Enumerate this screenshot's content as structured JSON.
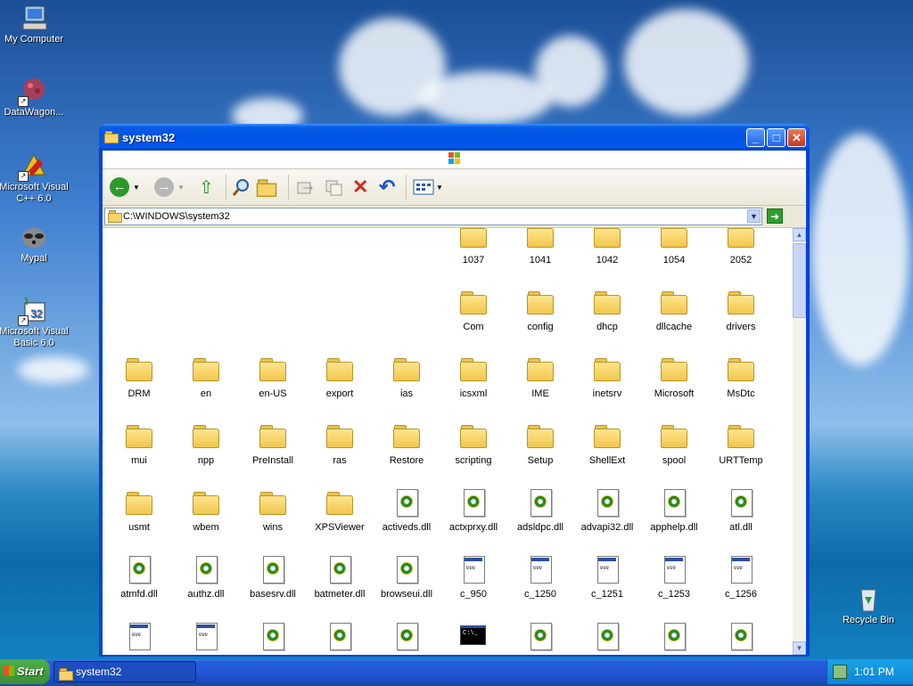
{
  "desktop": {
    "icons": [
      {
        "label": "My Computer"
      },
      {
        "label": "DataWagon..."
      },
      {
        "label": "Microsoft Visual C++ 6.0"
      },
      {
        "label": "Mypal"
      },
      {
        "label": "Microsoft Visual Basic 6.0"
      },
      {
        "label": "Recycle Bin"
      }
    ]
  },
  "window": {
    "title": "system32",
    "address": "C:\\WINDOWS\\system32"
  },
  "items": [
    {
      "label": "1037",
      "type": "folder"
    },
    {
      "label": "1041",
      "type": "folder"
    },
    {
      "label": "1042",
      "type": "folder"
    },
    {
      "label": "1054",
      "type": "folder"
    },
    {
      "label": "2052",
      "type": "folder"
    },
    {
      "label": "Com",
      "type": "folder"
    },
    {
      "label": "config",
      "type": "folder"
    },
    {
      "label": "dhcp",
      "type": "folder"
    },
    {
      "label": "dllcache",
      "type": "folder"
    },
    {
      "label": "drivers",
      "type": "folder"
    },
    {
      "label": "DRM",
      "type": "folder"
    },
    {
      "label": "en",
      "type": "folder"
    },
    {
      "label": "en-US",
      "type": "folder"
    },
    {
      "label": "export",
      "type": "folder"
    },
    {
      "label": "ias",
      "type": "folder"
    },
    {
      "label": "icsxml",
      "type": "folder"
    },
    {
      "label": "IME",
      "type": "folder"
    },
    {
      "label": "inetsrv",
      "type": "folder"
    },
    {
      "label": "Microsoft",
      "type": "folder"
    },
    {
      "label": "MsDtc",
      "type": "folder"
    },
    {
      "label": "mui",
      "type": "folder"
    },
    {
      "label": "npp",
      "type": "folder"
    },
    {
      "label": "PreInstall",
      "type": "folder"
    },
    {
      "label": "ras",
      "type": "folder"
    },
    {
      "label": "Restore",
      "type": "folder"
    },
    {
      "label": "scripting",
      "type": "folder"
    },
    {
      "label": "Setup",
      "type": "folder"
    },
    {
      "label": "ShellExt",
      "type": "folder"
    },
    {
      "label": "spool",
      "type": "folder"
    },
    {
      "label": "URTTemp",
      "type": "folder"
    },
    {
      "label": "usmt",
      "type": "folder"
    },
    {
      "label": "wbem",
      "type": "folder"
    },
    {
      "label": "wins",
      "type": "folder"
    },
    {
      "label": "XPSViewer",
      "type": "folder"
    },
    {
      "label": "activeds.dll",
      "type": "dll"
    },
    {
      "label": "actxprxy.dll",
      "type": "dll"
    },
    {
      "label": "adsldpc.dll",
      "type": "dll"
    },
    {
      "label": "advapi32.dll",
      "type": "dll"
    },
    {
      "label": "apphelp.dll",
      "type": "dll"
    },
    {
      "label": "atl.dll",
      "type": "dll"
    },
    {
      "label": "atmfd.dll",
      "type": "dll"
    },
    {
      "label": "authz.dll",
      "type": "dll"
    },
    {
      "label": "basesrv.dll",
      "type": "dll"
    },
    {
      "label": "batmeter.dll",
      "type": "dll"
    },
    {
      "label": "browseui.dll",
      "type": "dll"
    },
    {
      "label": "c_950",
      "type": "nls"
    },
    {
      "label": "c_1250",
      "type": "nls"
    },
    {
      "label": "c_1251",
      "type": "nls"
    },
    {
      "label": "c_1253",
      "type": "nls"
    },
    {
      "label": "c_1256",
      "type": "nls"
    },
    {
      "label": "",
      "type": "nls"
    },
    {
      "label": "",
      "type": "nls"
    },
    {
      "label": "",
      "type": "dll"
    },
    {
      "label": "",
      "type": "dll"
    },
    {
      "label": "",
      "type": "dll"
    },
    {
      "label": "",
      "type": "exe"
    },
    {
      "label": "",
      "type": "dll"
    },
    {
      "label": "",
      "type": "dll"
    },
    {
      "label": "",
      "type": "dll"
    },
    {
      "label": "",
      "type": "dll"
    }
  ],
  "taskbar": {
    "start_label": "Start",
    "task_label": "system32",
    "clock": "1:01 PM"
  }
}
